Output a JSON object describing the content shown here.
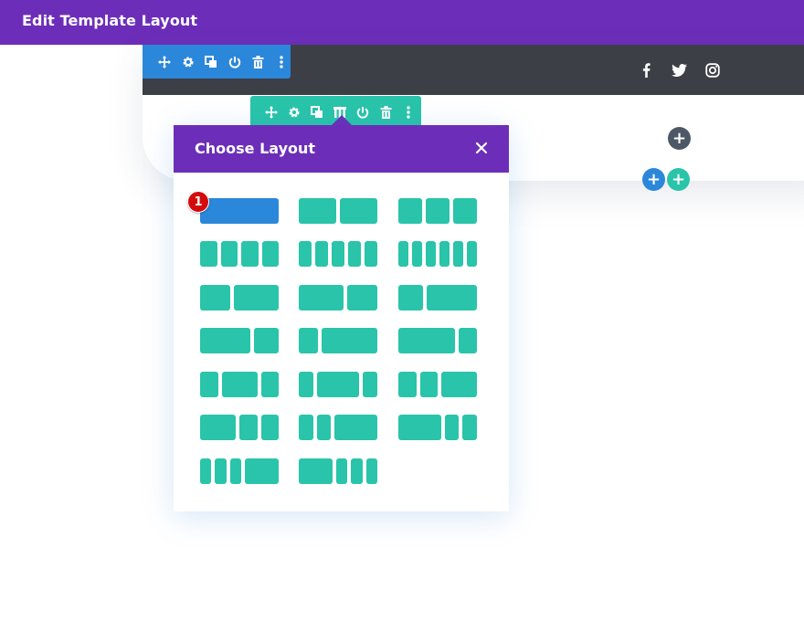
{
  "topbar": {
    "title": "Edit Template Layout",
    "bg": "#6c2eb9"
  },
  "colors": {
    "purple": "#6c2eb9",
    "blue": "#2b87da",
    "teal": "#29c4a9",
    "dark": "#3d3f46",
    "badge": "#d40b0b"
  },
  "section_toolbar": {
    "icons": [
      "move-icon",
      "gear-icon",
      "duplicate-icon",
      "power-icon",
      "trash-icon",
      "more-icon"
    ]
  },
  "row_toolbar": {
    "icons": [
      "move-icon",
      "gear-icon",
      "duplicate-icon",
      "columns-icon",
      "power-icon",
      "trash-icon",
      "more-icon"
    ]
  },
  "social_icons": [
    "facebook-icon",
    "twitter-icon",
    "instagram-icon"
  ],
  "add_buttons": {
    "symbol": "+"
  },
  "modal": {
    "title": "Choose Layout",
    "close_icon": "close-icon",
    "selected_index": 0,
    "layouts": [
      {
        "id": "1",
        "cols": [
          1
        ]
      },
      {
        "id": "1-2_1-2",
        "cols": [
          1,
          1
        ]
      },
      {
        "id": "1-3_1-3_1-3",
        "cols": [
          1,
          1,
          1
        ]
      },
      {
        "id": "1-4x4",
        "cols": [
          1,
          1,
          1,
          1
        ]
      },
      {
        "id": "1-5x5",
        "cols": [
          1,
          1,
          1,
          1,
          1
        ]
      },
      {
        "id": "1-6x6",
        "cols": [
          1,
          1,
          1,
          1,
          1,
          1
        ]
      },
      {
        "id": "2-5_3-5",
        "cols": [
          2,
          3
        ]
      },
      {
        "id": "3-5_2-5",
        "cols": [
          3,
          2
        ]
      },
      {
        "id": "1-3_2-3",
        "cols": [
          1,
          2
        ]
      },
      {
        "id": "2-3_1-3",
        "cols": [
          2,
          1
        ]
      },
      {
        "id": "1-4_3-4",
        "cols": [
          1,
          3
        ]
      },
      {
        "id": "3-4_1-4",
        "cols": [
          3,
          1
        ]
      },
      {
        "id": "1-4_1-2_1-4",
        "cols": [
          1,
          2,
          1
        ]
      },
      {
        "id": "1-5_3-5_1-5",
        "cols": [
          1,
          3,
          1
        ]
      },
      {
        "id": "1-4_1-4_1-2",
        "cols": [
          1,
          1,
          2
        ]
      },
      {
        "id": "1-2_1-4_1-4",
        "cols": [
          2,
          1,
          1
        ]
      },
      {
        "id": "1-5_1-5_3-5",
        "cols": [
          1,
          1,
          3
        ]
      },
      {
        "id": "3-5_1-5_1-5",
        "cols": [
          3,
          1,
          1
        ]
      },
      {
        "id": "1-6_1-6_1-6_1-2",
        "cols": [
          1,
          1,
          1,
          3
        ]
      },
      {
        "id": "1-2_1-6_1-6_1-6",
        "cols": [
          3,
          1,
          1,
          1
        ]
      }
    ]
  },
  "badge": {
    "number": "1"
  }
}
